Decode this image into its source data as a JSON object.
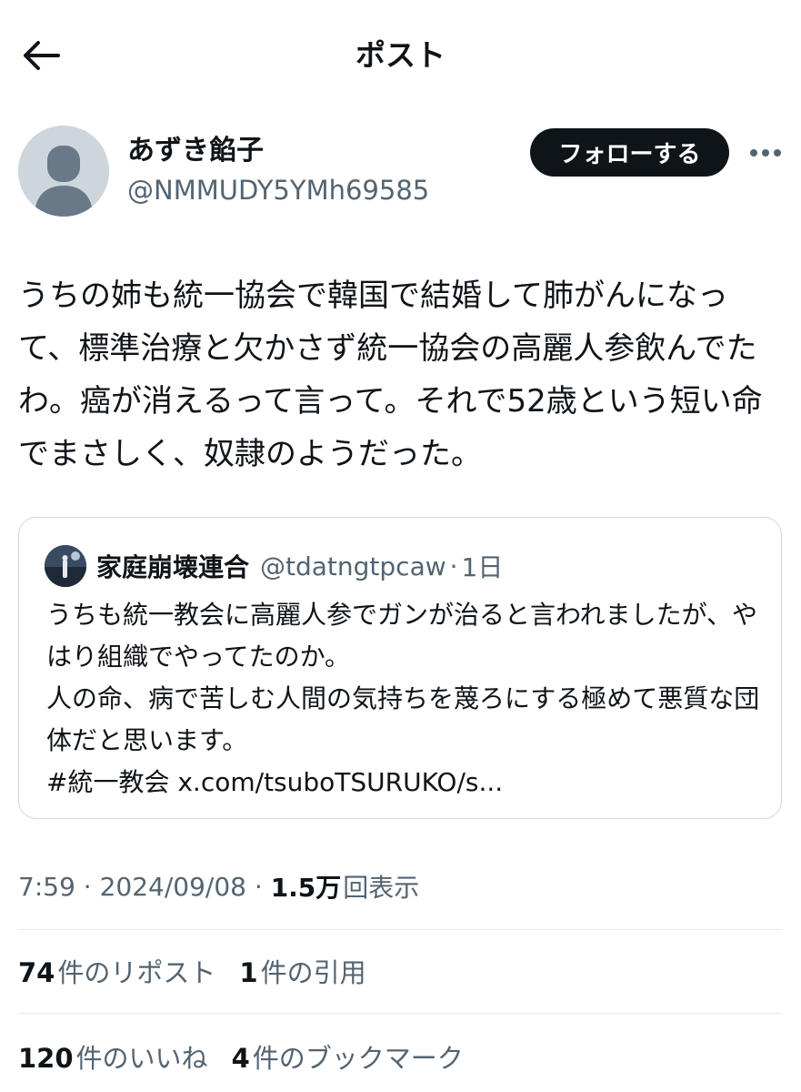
{
  "header": {
    "title": "ポスト",
    "back_icon": "arrow-left-icon"
  },
  "author": {
    "display_name": "あずき餡子",
    "handle": "@NMMUDY5YMh69585",
    "follow_label": "フォローする",
    "more_icon": "more-horizontal-icon"
  },
  "post": {
    "text": "うちの姉も統一協会で韓国で結婚して肺がんになって、標準治療と欠かさず統一協会の高麗人参飲んでたわ。癌が消えるって言って。それで52歳という短い命でまさしく、奴隷のようだった。"
  },
  "quote": {
    "display_name": "家庭崩壊連合",
    "handle": "@tdatngtpcaw",
    "separator": "·",
    "time": "1日",
    "text": "うちも統一教会に高麗人参でガンが治ると言われましたが、やはり組織でやってたのか。\n人の命、病で苦しむ人間の気持ちを蔑ろにする極めて悪質な団体だと思います。\n#統一教会 x.com/tsuboTSURUKO/s..."
  },
  "meta": {
    "time": "7:59",
    "sep1": " · ",
    "date": "2024/09/08",
    "sep2": " · ",
    "views_count": "1.5万",
    "views_label": "回表示"
  },
  "stats": {
    "reposts_count": "74",
    "reposts_label": "件のリポスト",
    "quotes_count": "1",
    "quotes_label": "件の引用",
    "likes_count": "120",
    "likes_label": "件のいいね",
    "bookmarks_count": "4",
    "bookmarks_label": "件のブックマーク"
  },
  "colors": {
    "text_primary": "#0f1419",
    "text_secondary": "#536471",
    "border": "#cfd9de",
    "follow_button_bg": "#0f1419"
  }
}
